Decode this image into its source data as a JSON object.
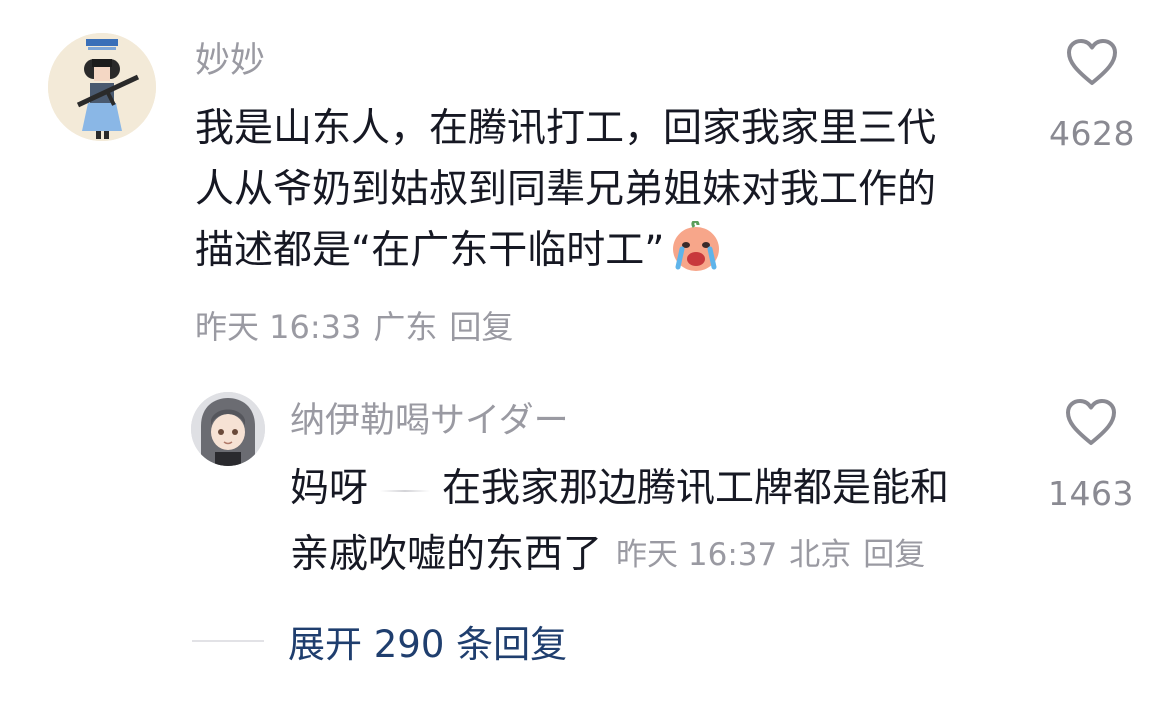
{
  "main_comment": {
    "username": "妙妙",
    "avatar_icon": "cartoon-girl-avatar",
    "lines": [
      "我是山东人，在腾讯打工，回家我家里三代",
      "人从爷奶到姑叔到同辈兄弟姐妹对我工作的",
      "描述都是“在广东干临时工”"
    ],
    "emoji": "crying-face-emoji",
    "time": "昨天 16:33",
    "location": "广东",
    "reply_label": "回复",
    "like_count": "4628",
    "like_icon": "heart-outline-icon"
  },
  "reply_comment": {
    "username": "纳伊勒喝サイダー",
    "avatar_icon": "anime-girl-avatar",
    "line1_a": "妈呀",
    "line1_b": "在我家那边腾讯工牌都是能和",
    "line2": "亲戚吹嘘的东西了",
    "time": "昨天 16:37",
    "location": "北京",
    "reply_label": "回复",
    "like_count": "1463",
    "like_icon": "heart-outline-icon"
  },
  "expand": {
    "label": "展开 290 条回复"
  },
  "colors": {
    "text": "#161823",
    "secondary": "#9a9aa2",
    "link": "#1f3e6e"
  }
}
